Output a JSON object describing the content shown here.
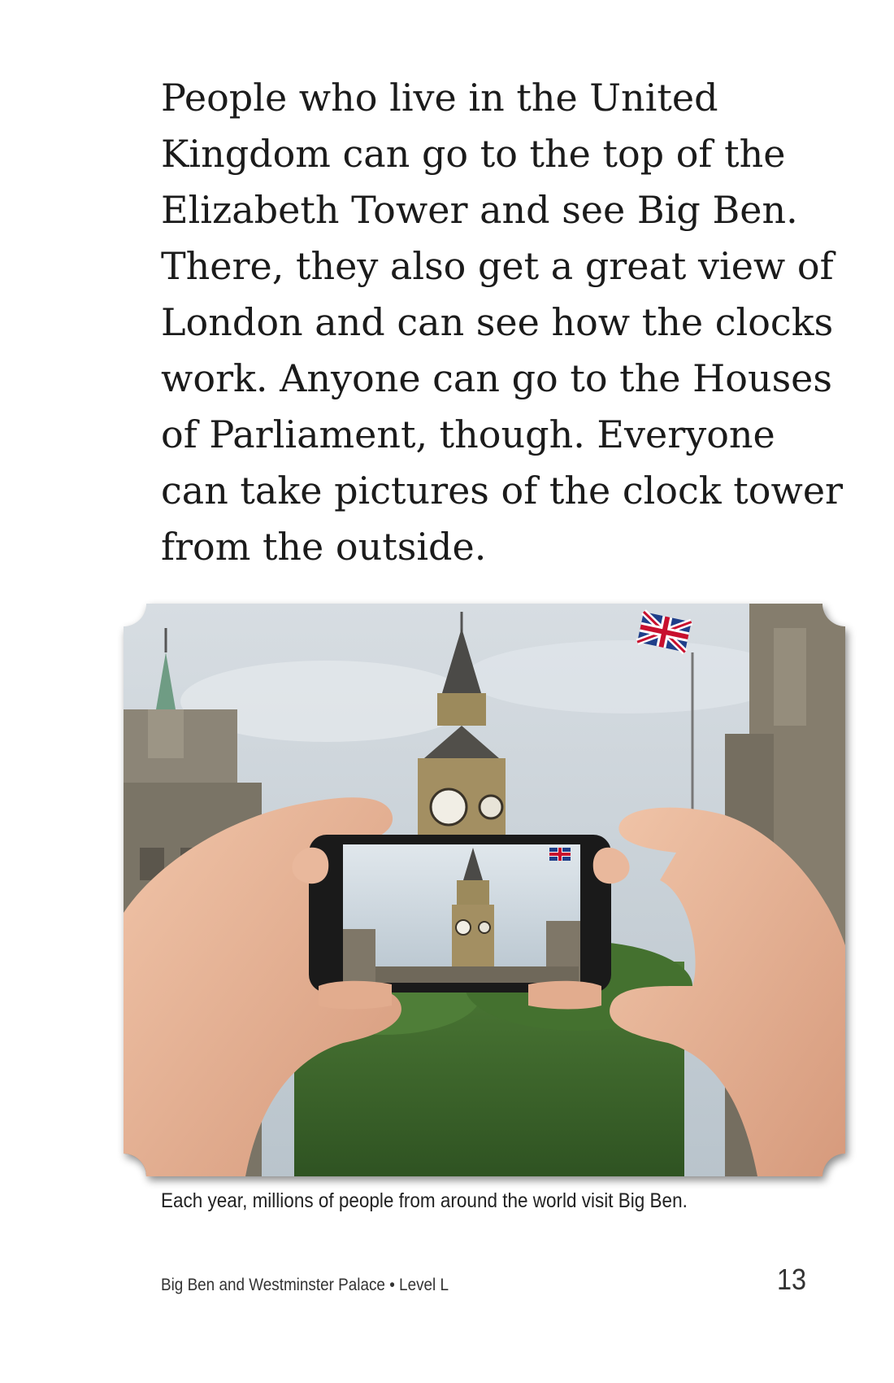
{
  "page": {
    "body_lines": [
      "People who live in the United",
      "Kingdom can go to the top of the",
      "Elizabeth Tower and see Big Ben.",
      "There, they also get a great view of",
      "London and can see how the clocks",
      "work. Anyone can go to the Houses",
      "of Parliament, though. Everyone",
      "can take pictures of the clock tower",
      "from the outside."
    ],
    "caption": "Each year, millions of people from around the world visit Big Ben.",
    "footer_title": "Big Ben and Westminster Palace • Level L",
    "page_number": "13"
  },
  "photo": {
    "subject": "hands holding smartphone photographing Big Ben",
    "icons": [
      "union-jack-flag-icon",
      "clock-face-icon",
      "smartphone-icon"
    ]
  },
  "colors": {
    "text": "#1b1b1b",
    "sky": "#c9d2d9",
    "tower_stone": "#9a8a66",
    "trees": "#3f6a2e",
    "skin": "#e8b79a"
  }
}
